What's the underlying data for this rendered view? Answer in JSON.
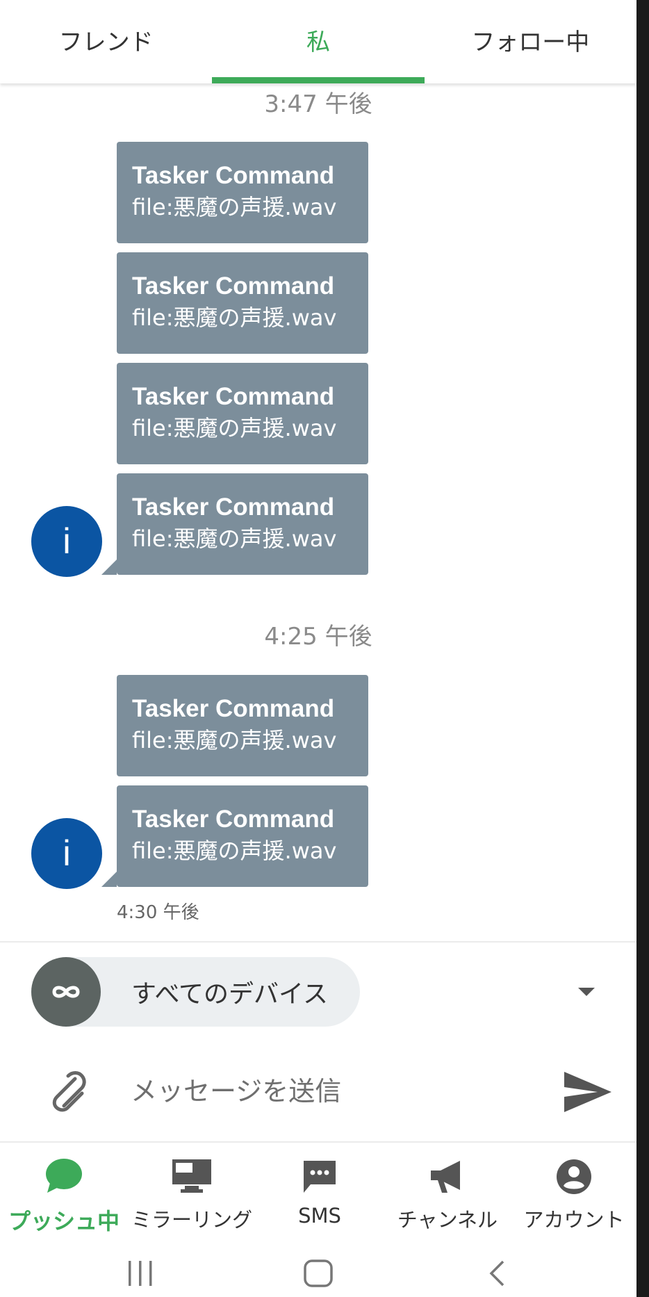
{
  "tabs": [
    {
      "label": "フレンド",
      "active": false
    },
    {
      "label": "私",
      "active": true
    },
    {
      "label": "フォロー中",
      "active": false
    }
  ],
  "messages": {
    "groups": [
      {
        "timestamp": "3:47 午後",
        "items": [
          {
            "title": "Tasker Command",
            "file": "file:悪魔の声援.wav"
          },
          {
            "title": "Tasker Command",
            "file": "file:悪魔の声援.wav"
          },
          {
            "title": "Tasker Command",
            "file": "file:悪魔の声援.wav"
          },
          {
            "title": "Tasker Command",
            "file": "file:悪魔の声援.wav"
          }
        ],
        "avatar_letter": "i"
      },
      {
        "timestamp": "4:25 午後",
        "items": [
          {
            "title": "Tasker Command",
            "file": "file:悪魔の声援.wav"
          },
          {
            "title": "Tasker Command",
            "file": "file:悪魔の声援.wav"
          }
        ],
        "avatar_letter": "i",
        "sent_time": "4:30 午後"
      }
    ]
  },
  "device_selector": {
    "label": "すべてのデバイス",
    "icon": "infinity-icon"
  },
  "compose": {
    "placeholder": "メッセージを送信",
    "attach_icon": "paperclip-icon",
    "send_icon": "send-icon"
  },
  "bottom_nav": [
    {
      "label": "プッシュ中",
      "icon": "chat-bubble-icon",
      "active": true
    },
    {
      "label": "ミラーリング",
      "icon": "monitor-icon",
      "active": false
    },
    {
      "label": "SMS",
      "icon": "sms-icon",
      "active": false
    },
    {
      "label": "チャンネル",
      "icon": "megaphone-icon",
      "active": false
    },
    {
      "label": "アカウント",
      "icon": "account-icon",
      "active": false
    }
  ],
  "colors": {
    "accent": "#3daa59",
    "bubble": "#7c8e9b",
    "avatar": "#0b55a3"
  }
}
